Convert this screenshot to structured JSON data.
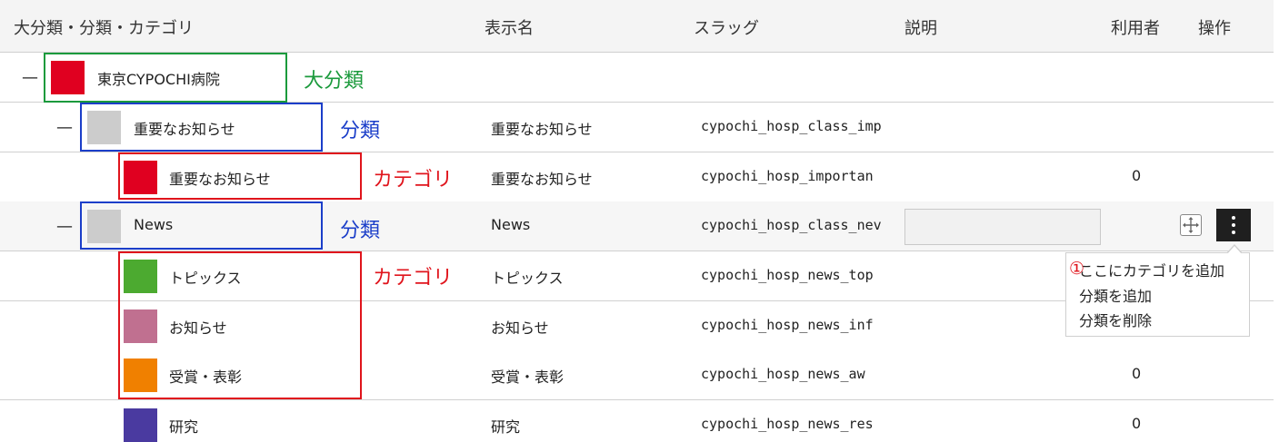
{
  "header": {
    "category_col": "大分類・分類・カテゴリ",
    "display_col": "表示名",
    "slug_col": "スラッグ",
    "description_col": "説明",
    "users_col": "利用者",
    "actions_col": "操作"
  },
  "rows": [
    {
      "toggle": "—",
      "name": "東京CYPOCHI病院",
      "display": "",
      "slug": "",
      "count": "",
      "color": "#e00020"
    },
    {
      "toggle": "—",
      "name": "重要なお知らせ",
      "display": "重要なお知らせ",
      "slug": "cypochi_hosp_class_imp",
      "count": "",
      "color": "#cccccc"
    },
    {
      "toggle": "",
      "name": "重要なお知らせ",
      "display": "重要なお知らせ",
      "slug": "cypochi_hosp_importan",
      "count": "0",
      "color": "#e00020"
    },
    {
      "toggle": "—",
      "name": "News",
      "display": "News",
      "slug": "cypochi_hosp_class_nev",
      "count": "",
      "color": "#cccccc"
    },
    {
      "toggle": "",
      "name": "トピックス",
      "display": "トピックス",
      "slug": "cypochi_hosp_news_top",
      "count": "",
      "color": "#4caa30"
    },
    {
      "toggle": "",
      "name": "お知らせ",
      "display": "お知らせ",
      "slug": "cypochi_hosp_news_inf",
      "count": "",
      "color": "#c07090"
    },
    {
      "toggle": "",
      "name": "受賞・表彰",
      "display": "受賞・表彰",
      "slug": "cypochi_hosp_news_aw",
      "count": "0",
      "color": "#f08000"
    },
    {
      "toggle": "",
      "name": "研究",
      "display": "研究",
      "slug": "cypochi_hosp_news_res",
      "count": "0",
      "color": "#4a3aa0"
    }
  ],
  "annotations": {
    "major": "大分類",
    "class1": "分類",
    "category1": "カテゴリ",
    "class2": "分類",
    "category2": "カテゴリ"
  },
  "context_menu": {
    "marker": "①",
    "items": [
      "ここにカテゴリを追加",
      "分類を追加",
      "分類を削除"
    ]
  },
  "icons": {
    "move": "move-arrows-icon",
    "more": "vertical-ellipsis-icon"
  }
}
